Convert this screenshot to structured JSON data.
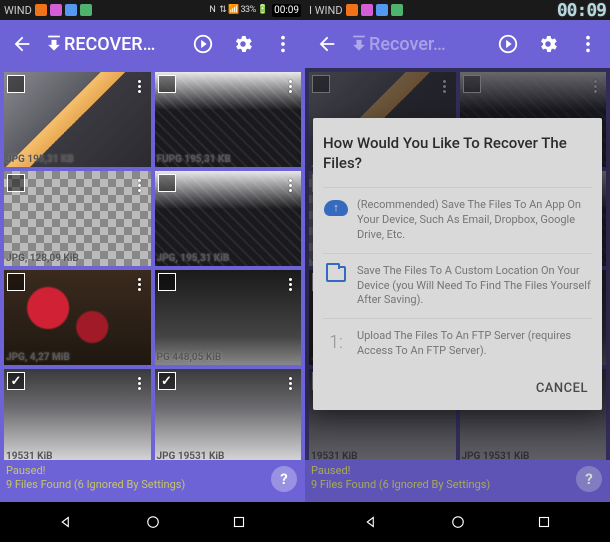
{
  "left": {
    "status": {
      "carrier": "WIND",
      "signals": "⇅ 📶 33% 🔋",
      "clock": "00:09",
      "nfc": "N"
    },
    "appbar": {
      "title": "RECOVER…"
    },
    "grid": [
      {
        "id": "t0",
        "checked": false,
        "caption": "JPG 195,31 KB",
        "img": "img-phone"
      },
      {
        "id": "t1",
        "checked": false,
        "caption": "FUPG 195,31 KB",
        "img": "img-kb"
      },
      {
        "id": "t2",
        "checked": false,
        "caption": "JPG, 128,09 KiB",
        "img": "img-chk"
      },
      {
        "id": "t3",
        "checked": false,
        "caption": "JPG, 195,31 KiB",
        "img": "img-kb"
      },
      {
        "id": "t4",
        "checked": false,
        "caption": "JPG, 4,27 MiB",
        "img": "img-flowers"
      },
      {
        "id": "t5",
        "checked": false,
        "caption": "PG 448,05 KiB",
        "img": "img-dark"
      },
      {
        "id": "t6",
        "checked": true,
        "caption": "19531 KiB",
        "img": "img-grey"
      },
      {
        "id": "t7",
        "checked": true,
        "caption": "JPG 19531 KiB",
        "img": "img-grey"
      }
    ],
    "footer": {
      "line1": "Paused!",
      "line2": "9 Files Found (6 Ignored By Settings)"
    }
  },
  "right": {
    "status": {
      "carrier": "I WIND",
      "clock": "00:09"
    },
    "appbar": {
      "title": "Recover…"
    },
    "footer": {
      "line1": "Paused!",
      "line2": "9 Files Found (6 Ignored By Settings)"
    },
    "dialog": {
      "title": "How Would You Like To Recover The Files?",
      "opt1": "(Recommended) Save The Files To An App On Your Device, Such As Email, Dropbox, Google Drive, Etc.",
      "opt2": "Save The Files To A Custom Location On Your Device (you Will Need To Find The Files Yourself After Saving).",
      "opt3num": "1:",
      "opt3": "Upload The Files To An FTP Server (requires Access To An FTP Server).",
      "cancel": "CANCEL"
    }
  }
}
